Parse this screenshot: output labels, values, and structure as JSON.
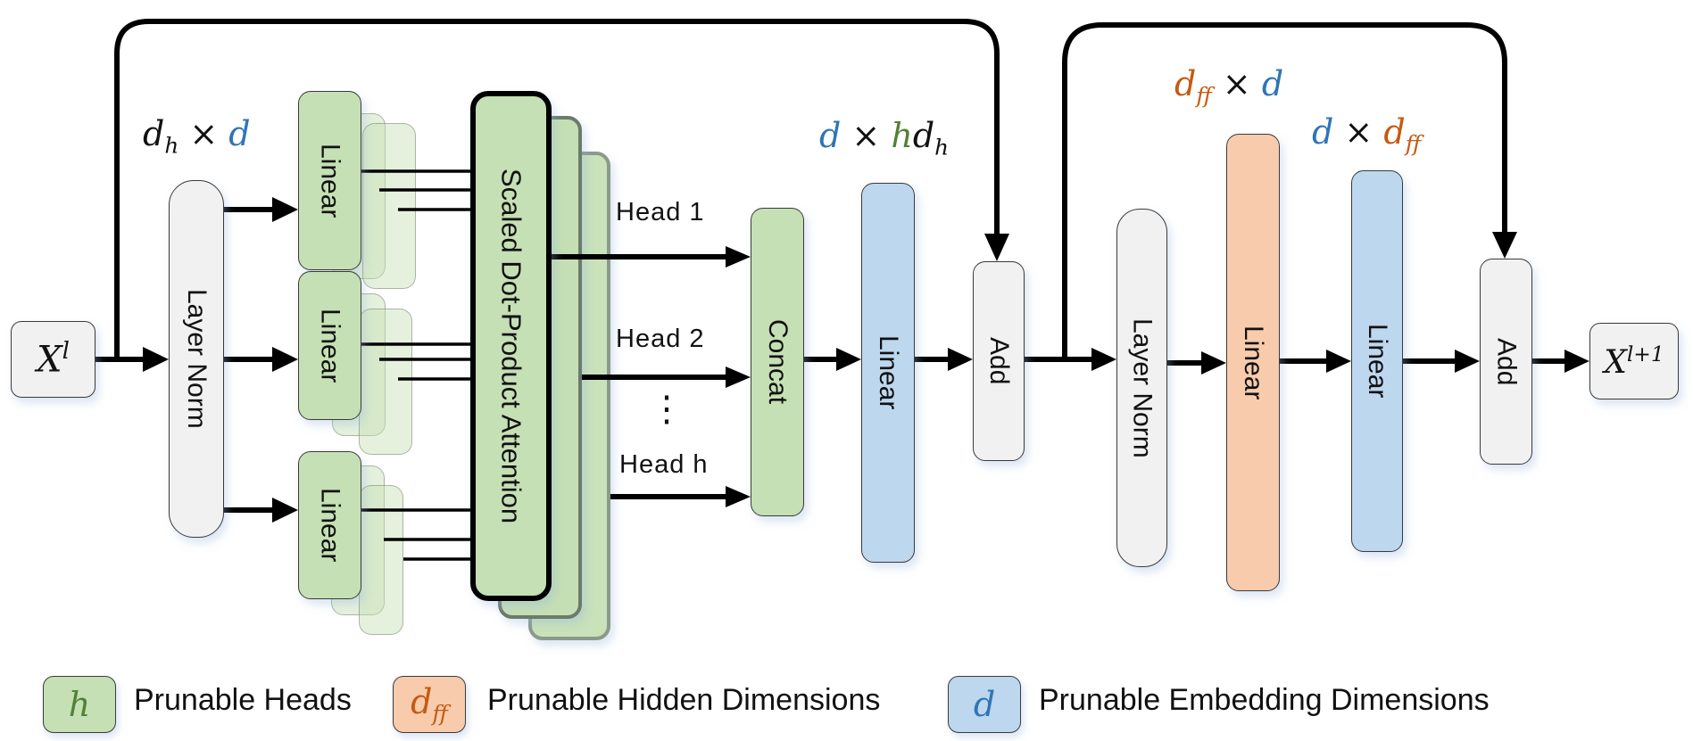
{
  "input": {
    "base": "X",
    "sup": "l"
  },
  "output": {
    "base": "X",
    "sup": "l+1"
  },
  "attention_block": {
    "layer_norm_label": "Layer Norm",
    "linear_label": "Linear",
    "attention_label": "Scaled Dot-Product Attention",
    "heads": [
      "Head 1",
      "Head 2",
      "Head h"
    ],
    "ellipsis": "⋮",
    "concat_label": "Concat",
    "out_linear_label": "Linear",
    "add_label": "Add",
    "dim_qkv": {
      "a": "d",
      "a_sub": "h",
      "times": "×",
      "b": "d"
    },
    "dim_out": {
      "a": "d",
      "times": "×",
      "b1": "h",
      "b2": "d",
      "b2_sub": "h"
    }
  },
  "ffn_block": {
    "layer_norm_label": "Layer Norm",
    "linear1_label": "Linear",
    "linear2_label": "Linear",
    "add_label": "Add",
    "dim_linear1": {
      "a": "d",
      "a_sub": "ff",
      "times": "×",
      "b": "d"
    },
    "dim_linear2": {
      "a": "d",
      "times": "×",
      "b": "d",
      "b_sub": "ff"
    }
  },
  "legend": [
    {
      "symbol": "h",
      "symbol_sub": "",
      "label": "Prunable Heads",
      "color": "#c5e0b4",
      "symbol_color": "#538135"
    },
    {
      "symbol": "d",
      "symbol_sub": "ff",
      "label": "Prunable Hidden Dimensions",
      "color": "#f8cbad",
      "symbol_color": "#c55a11"
    },
    {
      "symbol": "d",
      "symbol_sub": "",
      "label": "Prunable Embedding Dimensions",
      "color": "#bdd7ee",
      "symbol_color": "#2e75b6"
    }
  ],
  "colors": {
    "heads": "#c5e0b4",
    "hidden": "#f8cbad",
    "embedding": "#bdd7ee",
    "neutral": "#f1f1f1"
  }
}
